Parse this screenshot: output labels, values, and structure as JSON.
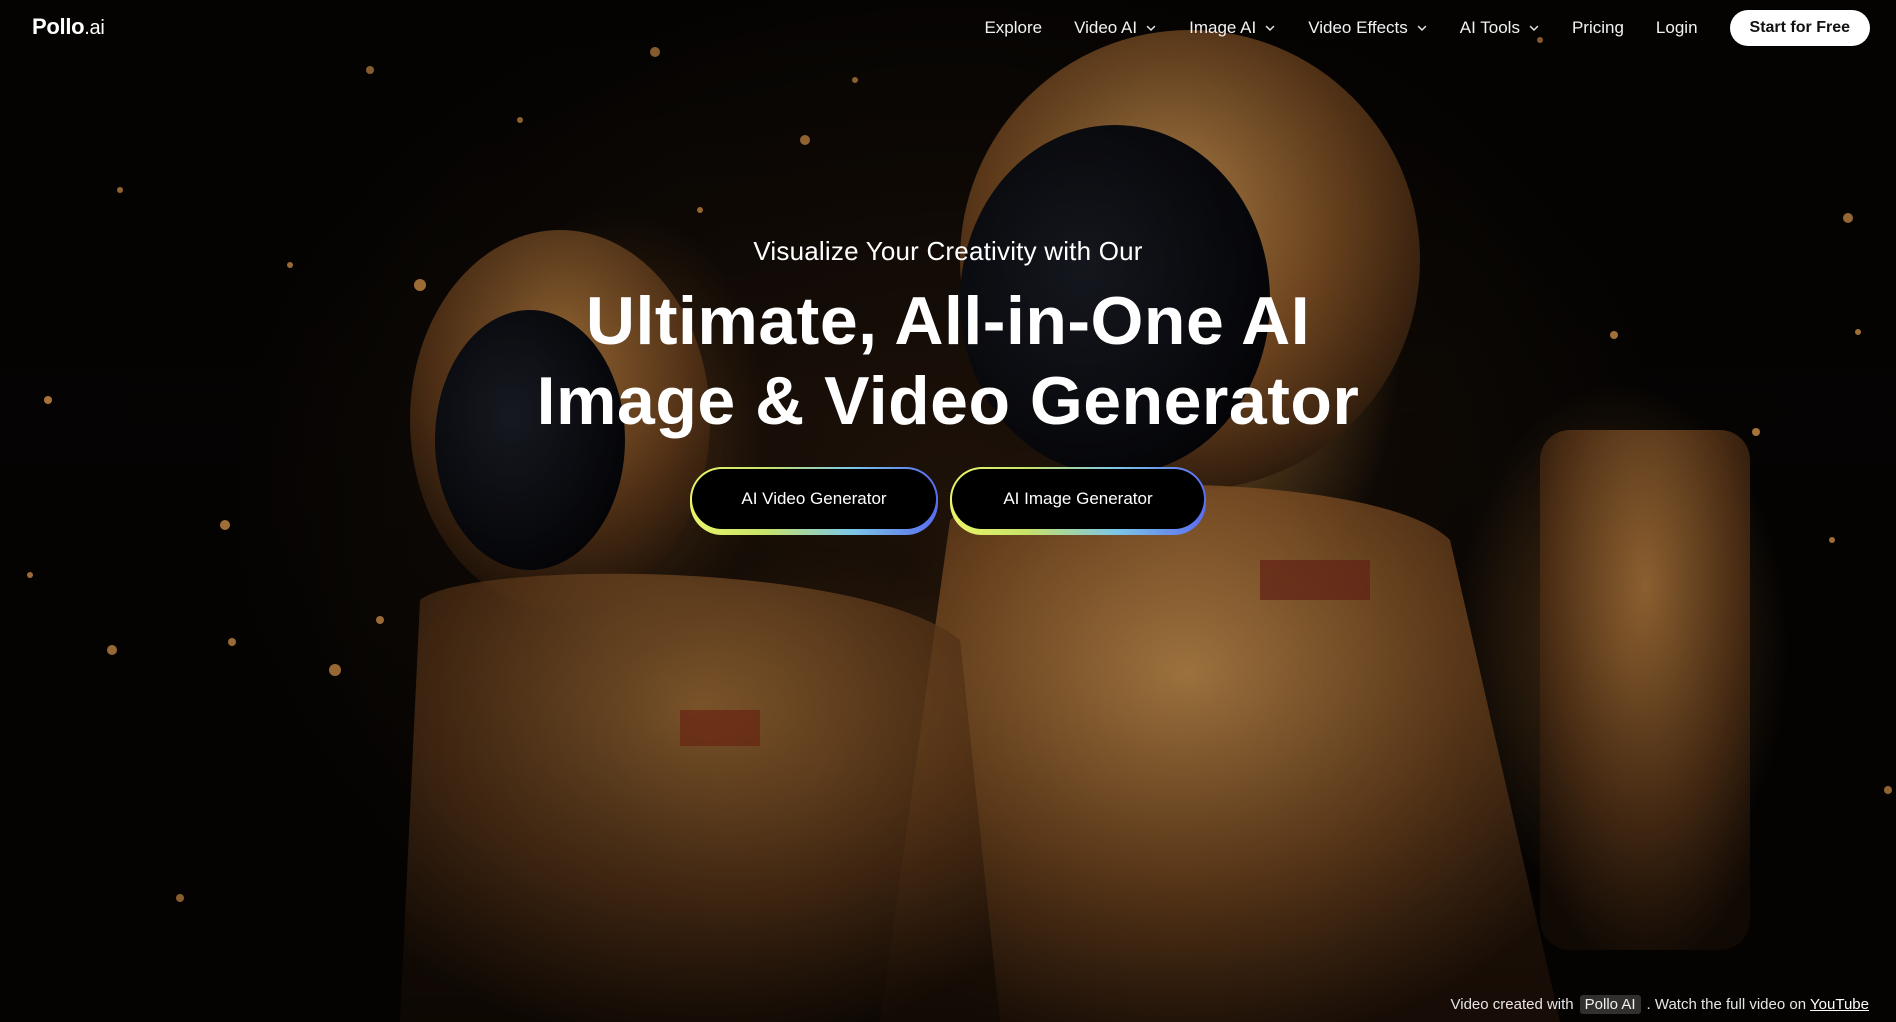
{
  "brand": {
    "name": "Pollo",
    "suffix": ".ai"
  },
  "nav": {
    "items": [
      {
        "label": "Explore",
        "has_dropdown": false
      },
      {
        "label": "Video AI",
        "has_dropdown": true
      },
      {
        "label": "Image AI",
        "has_dropdown": true
      },
      {
        "label": "Video Effects",
        "has_dropdown": true
      },
      {
        "label": "AI Tools",
        "has_dropdown": true
      },
      {
        "label": "Pricing",
        "has_dropdown": false
      },
      {
        "label": "Login",
        "has_dropdown": false
      }
    ],
    "cta_label": "Start for Free"
  },
  "hero": {
    "eyebrow": "Visualize Your Creativity with Our",
    "title_line1": "Ultimate, All-in-One AI",
    "title_line2": "Image & Video Generator",
    "buttons": {
      "video_label": "AI Video Generator",
      "image_label": "AI Image Generator"
    }
  },
  "credit": {
    "prefix": "Video created with",
    "tag": "Pollo AI",
    "middle": ". Watch the full video on",
    "link": "YouTube"
  },
  "colors": {
    "button_gradient_start": "#e9f56a",
    "button_gradient_end": "#5a6cf0",
    "cta_background": "#ffffff",
    "text": "#ffffff"
  }
}
